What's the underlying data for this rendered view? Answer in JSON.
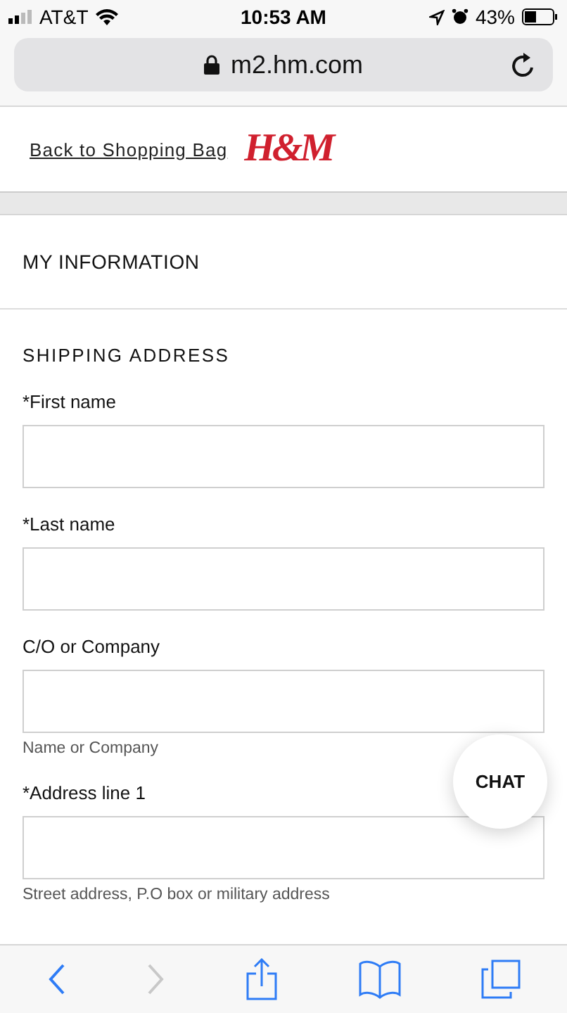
{
  "status_bar": {
    "carrier": "AT&T",
    "time": "10:53 AM",
    "battery": "43%"
  },
  "address_bar": {
    "url": "m2.hm.com"
  },
  "header": {
    "back_link": "Back to Shopping Bag",
    "logo": "H&M"
  },
  "section_title": "MY INFORMATION",
  "subsection_title": "SHIPPING ADDRESS",
  "fields": [
    {
      "label": "*First name"
    },
    {
      "label": "*Last name"
    },
    {
      "label": "C/O or Company",
      "hint": "Name or Company"
    },
    {
      "label": "*Address line 1",
      "hint": "Street address, P.O box or military address"
    }
  ],
  "chat_button": "CHAT",
  "toolbar": [
    {
      "kind": "back",
      "disabled": false
    },
    {
      "kind": "forward",
      "disabled": true
    },
    {
      "kind": "share",
      "disabled": false
    },
    {
      "kind": "bookmarks",
      "disabled": false
    },
    {
      "kind": "tabs",
      "disabled": false
    }
  ]
}
